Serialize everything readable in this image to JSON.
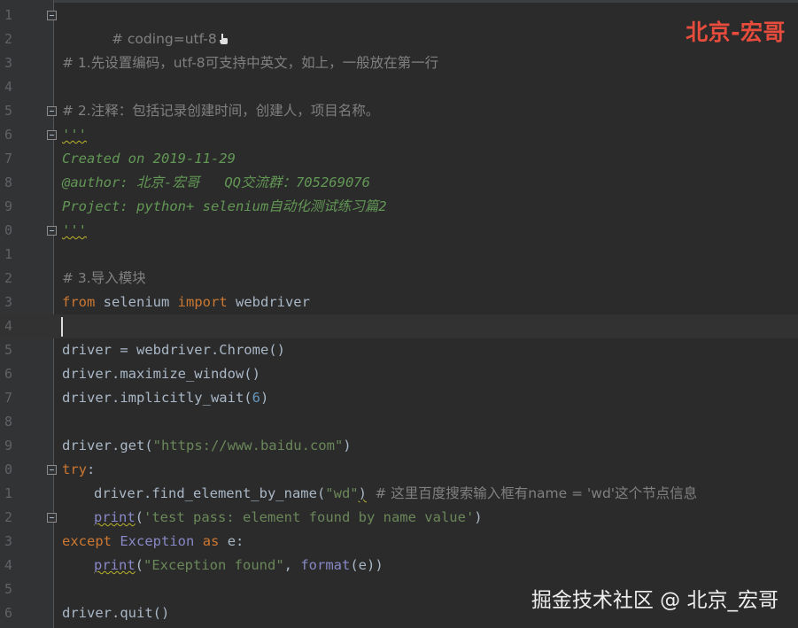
{
  "watermarks": {
    "top": "北京-宏哥",
    "bottom": "掘金技术社区 @ 北京_宏哥"
  },
  "lines": [
    {
      "n": "1",
      "l1": "# coding=utf-8"
    },
    {
      "n": "2"
    },
    {
      "n": "3",
      "l3": "# 1.先设置编码，utf-8可支持中英文，如上，一般放在第一行"
    },
    {
      "n": "4"
    },
    {
      "n": "5",
      "l5": "# 2.注释：包括记录创建时间，创建人，项目名称。"
    },
    {
      "n": "6",
      "l6": "'''"
    },
    {
      "n": "7",
      "l7": "Created on 2019-11-29"
    },
    {
      "n": "8",
      "l8": "@author: 北京-宏哥   QQ交流群：705269076"
    },
    {
      "n": "9",
      "l9": "Project: python+ selenium自动化测试练习篇2"
    },
    {
      "n": "0",
      "l10": "'''"
    },
    {
      "n": "1"
    },
    {
      "n": "2",
      "l12": "# 3.导入模块"
    },
    {
      "n": "3",
      "kw_from": "from",
      "mod": " selenium ",
      "kw_import": "import",
      "name": " webdriver"
    },
    {
      "n": "4"
    },
    {
      "n": "5",
      "l15": "driver = webdriver.Chrome()"
    },
    {
      "n": "6",
      "l16": "driver.maximize_window()"
    },
    {
      "n": "7",
      "a": "driver.implicitly_wait(",
      "num": "6",
      "b": ")"
    },
    {
      "n": "8"
    },
    {
      "n": "9",
      "a": "driver.get(",
      "str": "\"https://www.baidu.com\"",
      "b": ")"
    },
    {
      "n": "0",
      "kw": "try",
      "b": ":"
    },
    {
      "n": "1",
      "a": "driver.find_element_by_name(",
      "str": "\"wd\"",
      "b": ")",
      "comment": "# 这里百度搜索输入框有name = 'wd'这个节点信息"
    },
    {
      "n": "2",
      "fn": "print",
      "b": "(",
      "str": "'test pass: element found by name value'",
      "c": ")"
    },
    {
      "n": "3",
      "kw": "except",
      "cls": "Exception",
      "kw2": "as",
      "b": " e:"
    },
    {
      "n": "4",
      "fn": "print",
      "b": "(",
      "str": "\"Exception found\"",
      "c": ", ",
      "fn2": "format",
      "d": "(e))"
    },
    {
      "n": "5"
    },
    {
      "n": "6",
      "l26": "driver.quit()"
    }
  ]
}
